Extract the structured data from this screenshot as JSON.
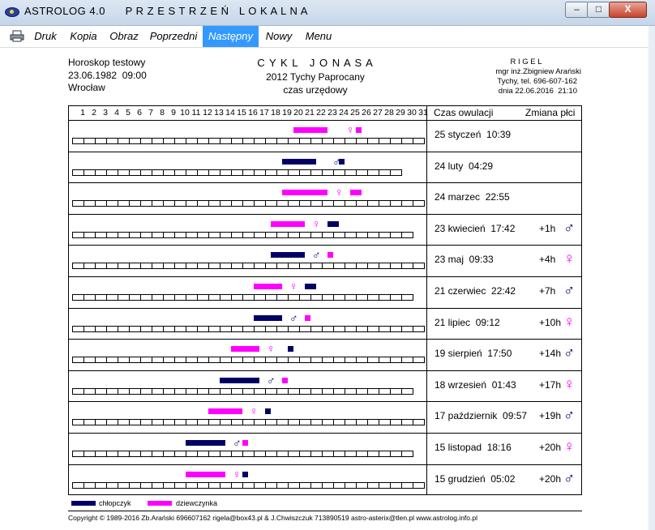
{
  "window": {
    "title": "ASTROLOG 4.0      P R Z E S T R Z E Ń   L O K A L N A",
    "min_label": "–",
    "max_label": "□",
    "close_label": "X"
  },
  "menu": {
    "items": [
      "Druk",
      "Kopia",
      "Obraz",
      "Poprzedni",
      "Następny",
      "Nowy",
      "Menu"
    ],
    "active": "Następny"
  },
  "header": {
    "left": [
      "Horoskop testowy",
      "23.06.1982  09:00",
      "Wrocław"
    ],
    "center": [
      "C Y K L   J O N A S A",
      "2012 Tychy Paprocany",
      "czas urzędowy"
    ],
    "right": [
      "R I G E L",
      "mgr inż.Zbigniew Arański",
      "Tychy, tel. 696-607-162",
      "dnia 22.06.2016  21:10"
    ]
  },
  "table": {
    "days": [
      "1",
      "2",
      "3",
      "4",
      "5",
      "6",
      "7",
      "8",
      "9",
      "10",
      "11",
      "12",
      "13",
      "14",
      "15",
      "16",
      "17",
      "18",
      "19",
      "20",
      "21",
      "22",
      "23",
      "24",
      "25",
      "26",
      "27",
      "28",
      "29",
      "30",
      "31"
    ],
    "col_ovulation": "Czas owulacji",
    "col_change": "Zmiana płci",
    "colors": {
      "boy": "#000066",
      "girl": "#ff00ff"
    },
    "rows": [
      {
        "date": "25 styczeń  10:39",
        "shift": "",
        "shift_sym": "",
        "shift_sex": "",
        "days_in_month": 31,
        "segments": [
          {
            "sex": "girl",
            "from": 20,
            "to": 23
          },
          {
            "sex": "girl",
            "from": 25.5,
            "to": 26
          }
        ],
        "marker": {
          "sex": "girl",
          "day": 25
        }
      },
      {
        "date": "24 luty  04:29",
        "shift": "",
        "shift_sym": "",
        "shift_sex": "",
        "days_in_month": 29,
        "segments": [
          {
            "sex": "boy",
            "from": 19,
            "to": 22
          },
          {
            "sex": "boy",
            "from": 24,
            "to": 24.5
          }
        ],
        "marker": {
          "sex": "boy",
          "day": 23.8
        }
      },
      {
        "date": "24 marzec  22:55",
        "shift": "",
        "shift_sym": "",
        "shift_sex": "",
        "days_in_month": 31,
        "segments": [
          {
            "sex": "girl",
            "from": 19,
            "to": 23
          },
          {
            "sex": "girl",
            "from": 25,
            "to": 26
          }
        ],
        "marker": {
          "sex": "girl",
          "day": 24
        }
      },
      {
        "date": "23 kwiecień  17:42",
        "shift": "+1h",
        "shift_sym": "♂",
        "shift_sex": "boy",
        "days_in_month": 30,
        "segments": [
          {
            "sex": "girl",
            "from": 18,
            "to": 21
          },
          {
            "sex": "boy",
            "from": 23,
            "to": 24
          }
        ],
        "marker": {
          "sex": "girl",
          "day": 22
        }
      },
      {
        "date": "23 maj  09:33",
        "shift": "+4h",
        "shift_sym": "♀",
        "shift_sex": "girl",
        "days_in_month": 31,
        "segments": [
          {
            "sex": "boy",
            "from": 18,
            "to": 21
          },
          {
            "sex": "girl",
            "from": 23,
            "to": 23.5
          }
        ],
        "marker": {
          "sex": "boy",
          "day": 22
        }
      },
      {
        "date": "21 czerwiec  22:42",
        "shift": "+7h",
        "shift_sym": "♂",
        "shift_sex": "boy",
        "days_in_month": 30,
        "segments": [
          {
            "sex": "girl",
            "from": 16.5,
            "to": 19
          },
          {
            "sex": "boy",
            "from": 21,
            "to": 22
          }
        ],
        "marker": {
          "sex": "girl",
          "day": 20
        }
      },
      {
        "date": "21 lipiec  09:12",
        "shift": "+10h",
        "shift_sym": "♀",
        "shift_sex": "girl",
        "days_in_month": 31,
        "segments": [
          {
            "sex": "boy",
            "from": 16.5,
            "to": 19
          },
          {
            "sex": "girl",
            "from": 21,
            "to": 21.5
          }
        ],
        "marker": {
          "sex": "boy",
          "day": 20
        }
      },
      {
        "date": "19 sierpień  17:50",
        "shift": "+14h",
        "shift_sym": "♂",
        "shift_sex": "boy",
        "days_in_month": 31,
        "segments": [
          {
            "sex": "girl",
            "from": 14.5,
            "to": 17
          },
          {
            "sex": "boy",
            "from": 19.5,
            "to": 20
          }
        ],
        "marker": {
          "sex": "girl",
          "day": 18
        }
      },
      {
        "date": "18 wrzesień  01:43",
        "shift": "+17h",
        "shift_sym": "♀",
        "shift_sex": "girl",
        "days_in_month": 30,
        "segments": [
          {
            "sex": "boy",
            "from": 13.5,
            "to": 17
          },
          {
            "sex": "girl",
            "from": 19,
            "to": 19.5
          }
        ],
        "marker": {
          "sex": "boy",
          "day": 18
        }
      },
      {
        "date": "17 październik  09:57",
        "shift": "+19h",
        "shift_sym": "♂",
        "shift_sex": "boy",
        "days_in_month": 31,
        "segments": [
          {
            "sex": "girl",
            "from": 12.5,
            "to": 15.5
          },
          {
            "sex": "boy",
            "from": 17.5,
            "to": 18
          }
        ],
        "marker": {
          "sex": "girl",
          "day": 16.5
        }
      },
      {
        "date": "15 listopad  18:16",
        "shift": "+20h",
        "shift_sym": "♀",
        "shift_sex": "girl",
        "days_in_month": 30,
        "segments": [
          {
            "sex": "boy",
            "from": 10.5,
            "to": 14
          },
          {
            "sex": "girl",
            "from": 15.5,
            "to": 16
          }
        ],
        "marker": {
          "sex": "boy",
          "day": 15
        }
      },
      {
        "date": "15 grudzień  05:02",
        "shift": "+20h",
        "shift_sym": "♂",
        "shift_sex": "boy",
        "days_in_month": 31,
        "segments": [
          {
            "sex": "girl",
            "from": 10.5,
            "to": 14
          },
          {
            "sex": "boy",
            "from": 15.5,
            "to": 16
          }
        ],
        "marker": {
          "sex": "girl",
          "day": 15
        }
      }
    ]
  },
  "legend": {
    "boy": "chłopczyk",
    "girl": "dziewczynka"
  },
  "copyright": "Copyright © 1989-2016 Zb.Arański 696607162 rigela@box43.pl & J.Chwiszczuk 713890519 astro-asterix@tlen.pl www.astrolog.info.pl"
}
